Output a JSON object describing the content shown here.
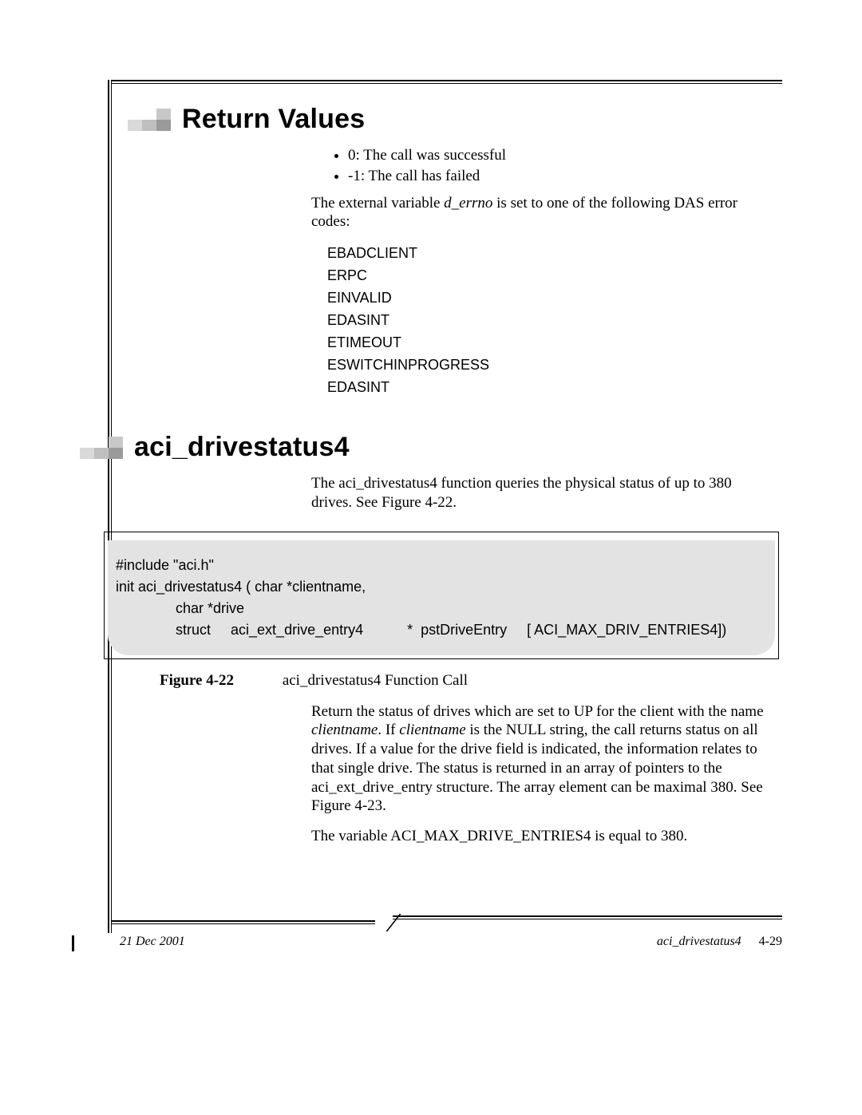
{
  "section1": {
    "title": "Return Values",
    "bullets": [
      "0: The call was successful",
      "-1: The call has failed"
    ],
    "errno_pre": "The external variable ",
    "errno_var": "d_errno",
    "errno_post": " is set to one of the following DAS error codes:",
    "error_codes": [
      "EBADCLIENT",
      "ERPC",
      "EINVALID",
      "EDASINT",
      "ETIMEOUT",
      "ESWITCHINPROGRESS",
      "EDASINT"
    ]
  },
  "section2": {
    "title": "aci_drivestatus4",
    "intro": "The aci_drivestatus4 function queries the physical status of up to 380 drives. See Figure 4-22.",
    "code": "#include \"aci.h\"\ninit aci_drivestatus4 ( char *clientname,\n               char *drive\n               struct     aci_ext_drive_entry4           *  pstDriveEntry     [ ACI_MAX_DRIV_ENTRIES4])",
    "figure_label": "Figure 4-22",
    "figure_caption": "aci_drivestatus4 Function Call",
    "desc_pre": "Return the status of drives which are set to UP for the client with the name ",
    "desc_cn1": "clientname",
    "desc_mid1": ". If ",
    "desc_cn2": "clientname",
    "desc_mid2": " is the NULL string, the call returns status on all drives. If a value for the drive field is indicated, the information relates to that single drive. The status is returned in an array of pointers to the aci_ext_drive_entry structure. The array element can be maximal 380. See Figure 4-23.",
    "desc2": "The variable ACI_MAX_DRIVE_ENTRIES4 is equal to 380."
  },
  "footer": {
    "date": "21 Dec 2001",
    "ref": "aci_drivestatus4",
    "page": "4-29"
  }
}
